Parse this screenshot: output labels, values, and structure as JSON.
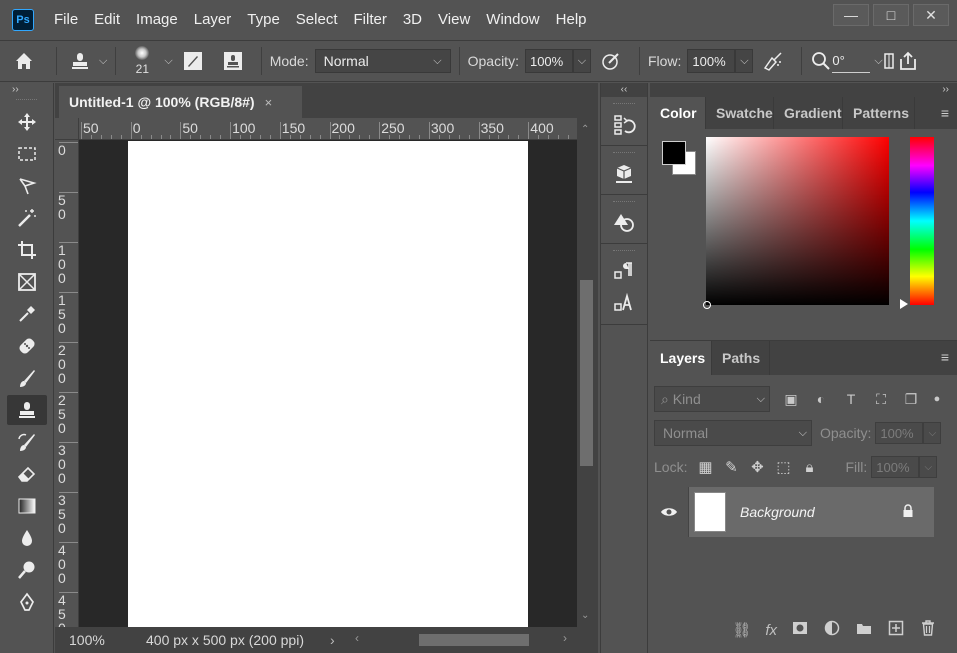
{
  "app": {
    "logo_text": "Ps",
    "menu": [
      "File",
      "Edit",
      "Image",
      "Layer",
      "Type",
      "Select",
      "Filter",
      "3D",
      "View",
      "Window",
      "Help"
    ],
    "window_controls": {
      "minimize": "—",
      "restore": "□",
      "close": "✕"
    }
  },
  "options_bar": {
    "brush_size": "21",
    "mode_label": "Mode:",
    "mode_value": "Normal",
    "opacity_label": "Opacity:",
    "opacity_value": "100%",
    "flow_label": "Flow:",
    "flow_value": "100%",
    "angle_value": "0°"
  },
  "tools": {
    "collapse_glyph": "››",
    "items": [
      "move",
      "marquee",
      "lasso",
      "magic-wand",
      "crop",
      "frame",
      "eyedropper",
      "healing",
      "brush",
      "clone-stamp",
      "history-brush",
      "eraser",
      "gradient",
      "blur",
      "dodge",
      "pen"
    ],
    "active": "clone-stamp"
  },
  "document": {
    "tab_title": "Untitled-1 @ 100% (RGB/8#)",
    "tab_close": "×",
    "ruler_top_labels": [
      "50",
      "0",
      "50",
      "100",
      "150",
      "200",
      "250",
      "300",
      "350",
      "400"
    ],
    "ruler_left_labels": [
      "0",
      "5 0",
      "1 0 0",
      "1 5 0",
      "2 0 0",
      "2 5 0",
      "3 0 0",
      "3 5 0",
      "4 0 0",
      "4 5 0"
    ],
    "zoom": "100%",
    "info": "400 px x 500 px (200 ppi)",
    "info_arrow": "›"
  },
  "dock": {
    "collapse_glyph": "‹‹"
  },
  "color_panel": {
    "expand_glyph": "››",
    "tabs": [
      "Color",
      "Swatches",
      "Gradients",
      "Patterns"
    ],
    "active_tab": "Color",
    "foreground": "#000000",
    "background": "#ffffff"
  },
  "layers_panel": {
    "tabs": [
      "Layers",
      "Paths"
    ],
    "active_tab": "Layers",
    "kind_placeholder": "Kind",
    "blend_mode": "Normal",
    "opacity_label": "Opacity:",
    "opacity_value": "100%",
    "lock_label": "Lock:",
    "fill_label": "Fill:",
    "fill_value": "100%",
    "layers": [
      {
        "name": "Background",
        "visible": true,
        "locked": true
      }
    ]
  }
}
